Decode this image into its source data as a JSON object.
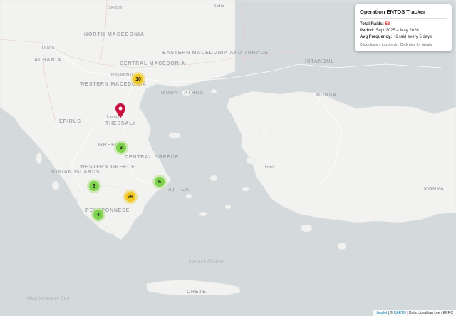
{
  "info": {
    "title": "Operation ENTOS Tracker",
    "total_label": "Total Raids:",
    "total_value": "53",
    "period_label": "Period:",
    "period_value": "Sept 2025 – May 2026",
    "freq_label": "Avg Frequency:",
    "freq_value": "~1 raid every 5 days",
    "hint": "Click clusters to zoom in. Click pins for details."
  },
  "clusters": [
    {
      "count": "10",
      "size": "medium"
    },
    {
      "count": "3",
      "size": "small"
    },
    {
      "count": "3",
      "size": "small"
    },
    {
      "count": "6",
      "size": "small"
    },
    {
      "count": "26",
      "size": "medium"
    },
    {
      "count": "4",
      "size": "small"
    }
  ],
  "labels": {
    "north_macedonia": "NORTH MACEDONIA",
    "albania": "ALBANIA",
    "central_macedonia": "CENTRAL MACEDONIA",
    "east_macedonia": "EASTERN MACEDONIA AND THRACE",
    "western_macedonia": "WESTERN MACEDONIA",
    "epirus": "EPIRUS",
    "thessaly": "THESSALY",
    "central_greece": "CENTRAL GREECE",
    "western_greece": "WESTERN GREECE",
    "ionian": "IONIAN ISLANDS",
    "peloponnese": "PELOPONNESE",
    "attica": "ATTICA",
    "greece": "GREECE",
    "mount_athos": "MOUNT ATHOS",
    "crete": "CRETE",
    "cretan_sea": "Κρητικό Πέλαγος",
    "med_sea": "Mediterranean Sea",
    "thessaloniki": "Thessaloniki",
    "istanbul": "İSTANBUL",
    "bursa": "BURSA",
    "izmir": "İzmir",
    "konya": "KONYA",
    "larissa": "Larissa",
    "tirana": "Tirana",
    "skopje": "Skopje",
    "sofia": "Sofia"
  },
  "attribution": {
    "leaflet": "Leaflet",
    "sep": " | © ",
    "carto": "CARTO",
    "data": " | Data: Jonathan Lee / ERRC"
  },
  "colors": {
    "land": "#f2f2f0",
    "sea": "#d4dadc",
    "pin": "#c8103e"
  }
}
